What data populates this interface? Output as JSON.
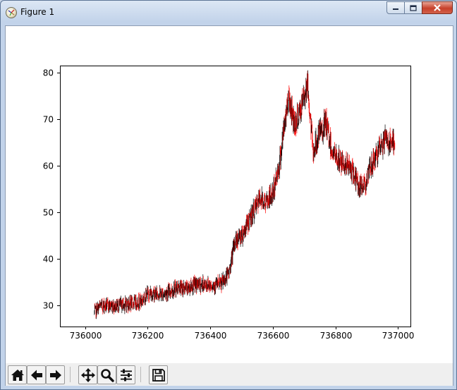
{
  "window": {
    "title": "Figure 1",
    "controls": [
      "minimize",
      "maximize",
      "close"
    ]
  },
  "toolbar": {
    "buttons": [
      "home-icon",
      "back-arrow-icon",
      "forward-arrow-icon",
      "pan-icon",
      "zoom-icon",
      "configure-subplots-icon",
      "save-icon"
    ]
  },
  "chart_data": {
    "type": "candlestick",
    "title": "",
    "xlabel": "",
    "ylabel": "",
    "xlim": [
      735920,
      737040
    ],
    "ylim": [
      25.5,
      81.5
    ],
    "xticks": [
      736000,
      736200,
      736400,
      736600,
      736800,
      737000
    ],
    "xtick_labels": [
      "736000",
      "736200",
      "736400",
      "736600",
      "736800",
      "737000"
    ],
    "yticks": [
      30,
      40,
      50,
      60,
      70,
      80
    ],
    "ytick_labels": [
      "30",
      "40",
      "50",
      "60",
      "70",
      "80"
    ],
    "grid": false,
    "colors": {
      "up": "#000000",
      "down": "#ff0000",
      "axes": "#000000"
    },
    "price_path": {
      "x": [
        736030,
        736050,
        736100,
        736150,
        736180,
        736200,
        736250,
        736300,
        736320,
        736350,
        736400,
        736430,
        736440,
        736460,
        736480,
        736500,
        736530,
        736560,
        736580,
        736600,
        736620,
        736640,
        736650,
        736670,
        736690,
        736710,
        736720,
        736730,
        736750,
        736770,
        736790,
        736810,
        736840,
        736860,
        736880,
        736900,
        736920,
        736940,
        736960,
        736980,
        736990
      ],
      "y": [
        28.5,
        30,
        30,
        30.5,
        31,
        32.5,
        32.5,
        34,
        33.5,
        34.5,
        34.5,
        34.5,
        35,
        37,
        44,
        45,
        49,
        53,
        52,
        54,
        60,
        70,
        75,
        69,
        72,
        78,
        70,
        63,
        67,
        69,
        63,
        61,
        60,
        58,
        55,
        57,
        61,
        63,
        66,
        64,
        66
      ]
    }
  }
}
